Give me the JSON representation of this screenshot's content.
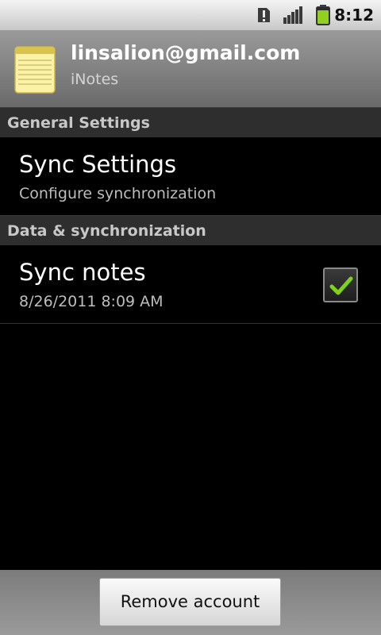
{
  "status_bar": {
    "time": "8:12",
    "icons": [
      "alert-icon",
      "signal-icon",
      "battery-icon"
    ],
    "battery_color": "#8fd11e"
  },
  "account": {
    "email": "linsalion@gmail.com",
    "app_name": "iNotes",
    "icon": "notepad-icon"
  },
  "sections": [
    {
      "header": "General Settings",
      "items": [
        {
          "title": "Sync Settings",
          "summary": "Configure synchronization"
        }
      ]
    },
    {
      "header": "Data & synchronization",
      "items": [
        {
          "title": "Sync notes",
          "summary": "8/26/2011 8:09 AM",
          "checked": true
        }
      ]
    }
  ],
  "footer": {
    "remove_label": "Remove account"
  },
  "colors": {
    "checkmark": "#7fd11b",
    "section_header_bg": "#2e2e2e"
  }
}
